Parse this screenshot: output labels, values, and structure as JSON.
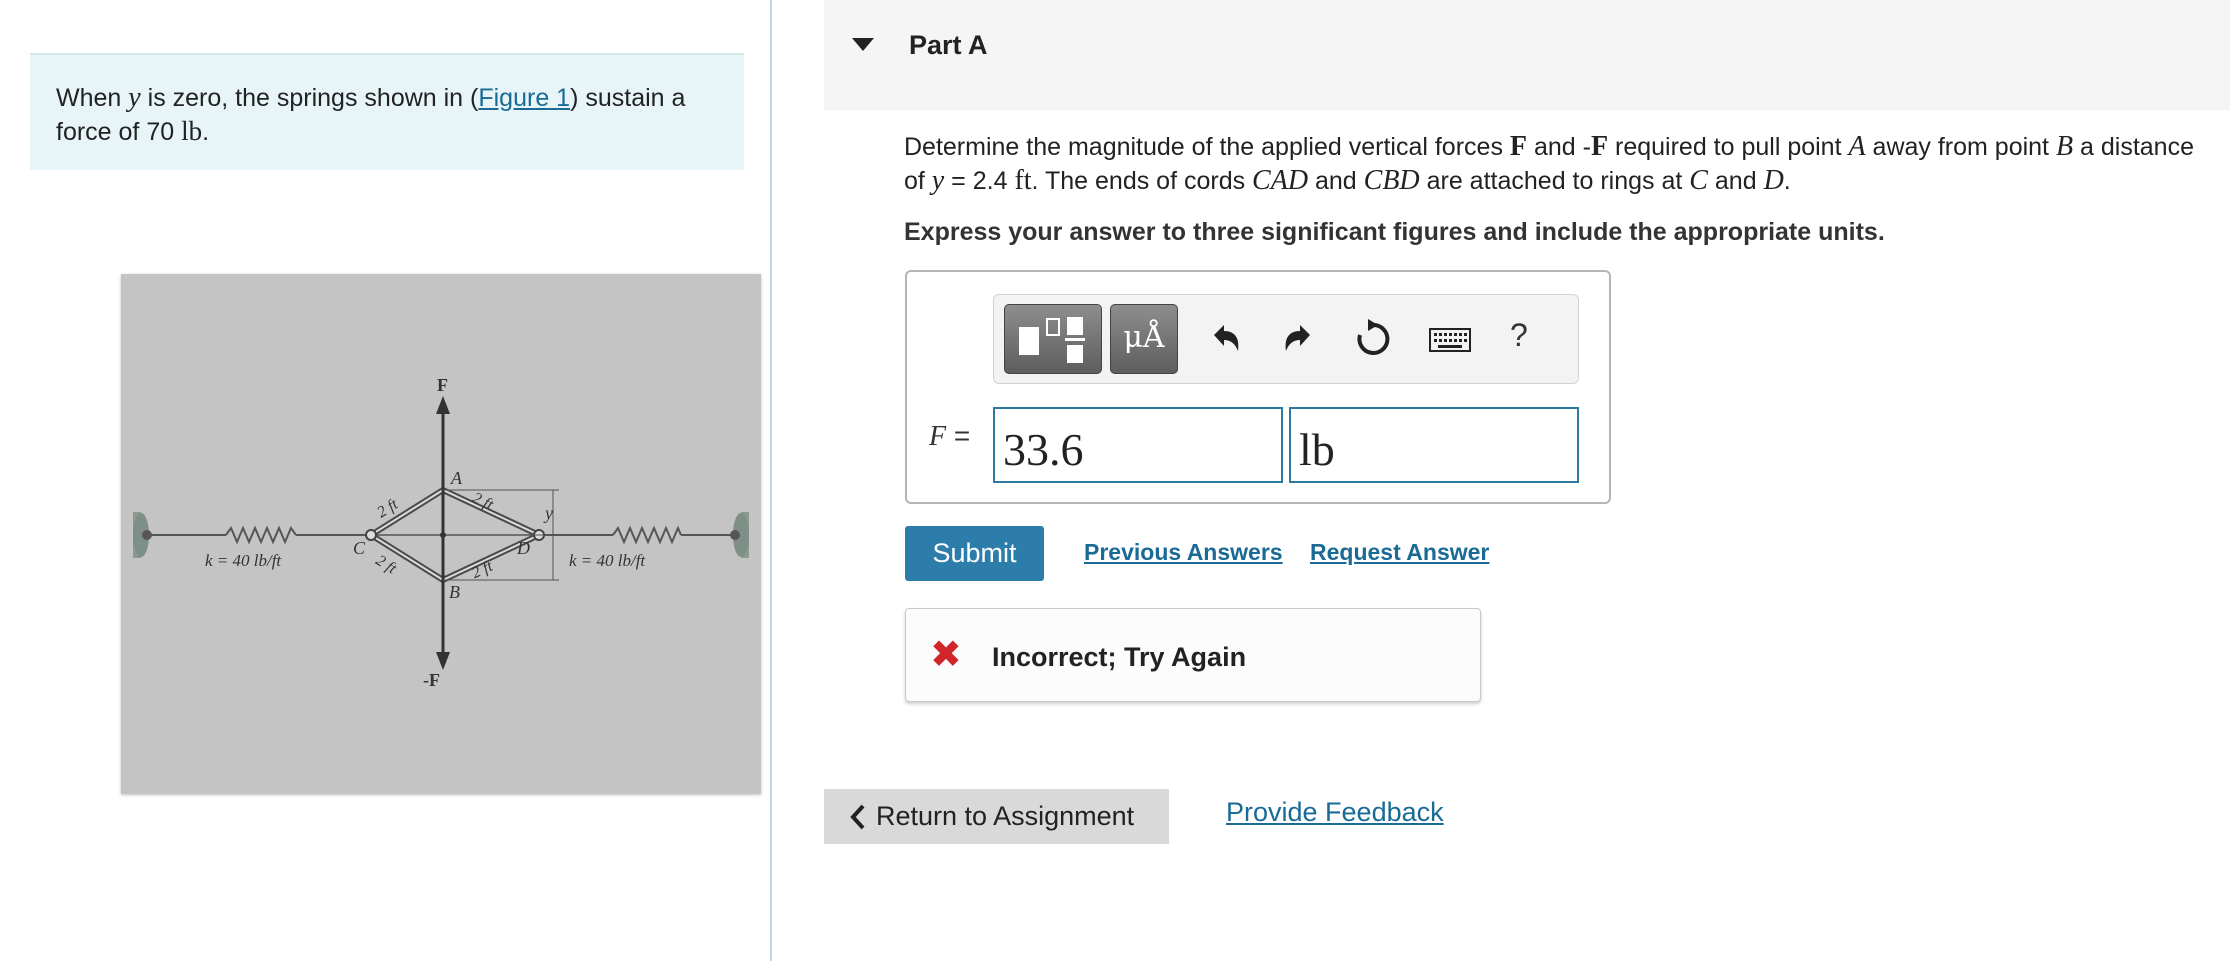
{
  "intro": {
    "text_1": "When ",
    "var_y": "y",
    "text_2": " is zero, the springs shown in (",
    "figure_link": "Figure 1",
    "text_3": ") sustain a force of 70 ",
    "unit_lb": "lb",
    "text_4": "."
  },
  "figure": {
    "label_F": "F",
    "label_negF": "-F",
    "label_A": "A",
    "label_B": "B",
    "label_C": "C",
    "label_D": "D",
    "label_y": "y",
    "label_2ft_1": "2 ft",
    "label_2ft_2": "2 ft",
    "label_2ft_3": "2 ft",
    "label_2ft_4": "2 ft",
    "label_k_left": "k = 40 lb/ft",
    "label_k_right": "k = 40 lb/ft"
  },
  "part": {
    "title": "Part A"
  },
  "question": {
    "t1": "Determine the magnitude of the applied vertical forces ",
    "F": "F",
    "t2": " and -",
    "F2": "F",
    "t3": " required to pull point ",
    "A": "A",
    "t4": " away from point ",
    "B": "B",
    "t5": " a distance of ",
    "y": "y",
    "t6": " = 2.4 ",
    "ft": "ft",
    "t7": ". The ends of cords ",
    "CAD": "CAD",
    "t8": " and ",
    "CBD": "CBD",
    "t9": " are attached to rings at ",
    "C": "C",
    "t10": " and ",
    "D": "D",
    "t11": "."
  },
  "instruction": "Express your answer to three significant figures and include the appropriate units.",
  "toolbar": {
    "units_label": "μÅ",
    "help_label": "?"
  },
  "answer": {
    "var_label": "F",
    "equals": " =",
    "value": "33.6",
    "unit": "lb"
  },
  "actions": {
    "submit": "Submit",
    "previous_answers": "Previous Answers",
    "request_answer": "Request Answer"
  },
  "feedback": {
    "icon": "✖",
    "text": "Incorrect; Try Again"
  },
  "footer": {
    "return_label": "Return to Assignment",
    "provide_feedback": "Provide Feedback"
  }
}
